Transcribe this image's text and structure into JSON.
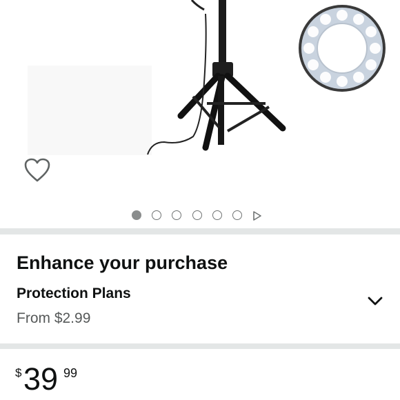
{
  "gallery": {
    "image_count": 6,
    "active_index": 0,
    "image_description_name": "ring-light-tripod-product-image"
  },
  "enhance": {
    "title": "Enhance your purchase",
    "protection": {
      "label": "Protection Plans",
      "price": "From $2.99"
    }
  },
  "price": {
    "symbol": "$",
    "whole": "39",
    "fraction": "99"
  },
  "icons": {
    "wishlist": "heart-outline-icon",
    "gallery_next": "play-triangle-icon",
    "expand": "chevron-down-icon"
  },
  "colors": {
    "text": "#0f1111",
    "secondary_text": "#565959",
    "separator": "#e3e6e6",
    "dot_active": "#8a8d8d"
  }
}
